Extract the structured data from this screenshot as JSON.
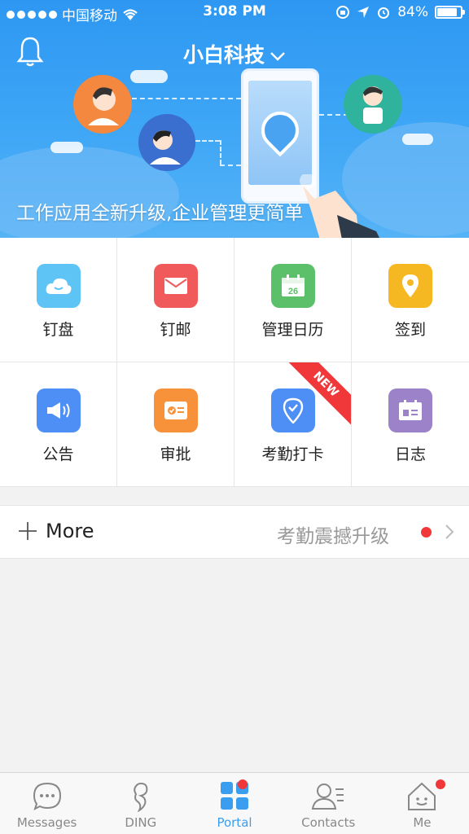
{
  "status_bar": {
    "carrier": "中国移动",
    "time": "3:08 PM",
    "battery_percent": "84%",
    "battery_level": 0.84
  },
  "header": {
    "org_name": "小白科技",
    "banner_text": "工作应用全新升级,企业管理更简单"
  },
  "apps": [
    {
      "label": "钉盘",
      "icon": "cloud-icon",
      "color": "#5ec4f5"
    },
    {
      "label": "钉邮",
      "icon": "mail-icon",
      "color": "#f15a5a"
    },
    {
      "label": "管理日历",
      "icon": "calendar-icon",
      "color": "#5cbf6a",
      "icon_text": "26"
    },
    {
      "label": "签到",
      "icon": "location-pin-icon",
      "color": "#f5b822"
    },
    {
      "label": "公告",
      "icon": "megaphone-icon",
      "color": "#4d8ff5"
    },
    {
      "label": "审批",
      "icon": "approval-card-icon",
      "color": "#f7923a"
    },
    {
      "label": "考勤打卡",
      "icon": "check-in-pin-icon",
      "color": "#4d8ff5",
      "badge": "NEW"
    },
    {
      "label": "日志",
      "icon": "log-icon",
      "color": "#9b82c9"
    }
  ],
  "more": {
    "label": "More",
    "promo": "考勤震撼升级"
  },
  "tabs": [
    {
      "label": "Messages",
      "icon": "chat-bubble-icon",
      "active": false,
      "dot": false
    },
    {
      "label": "DING",
      "icon": "ding-icon",
      "active": false,
      "dot": false
    },
    {
      "label": "Portal",
      "icon": "portal-grid-icon",
      "active": true,
      "dot": true
    },
    {
      "label": "Contacts",
      "icon": "contacts-icon",
      "active": false,
      "dot": false
    },
    {
      "label": "Me",
      "icon": "home-face-icon",
      "active": false,
      "dot": true
    }
  ],
  "colors": {
    "accent": "#3a9ef0",
    "badge_red": "#f0383a",
    "banner_blue": "#2d97f2"
  }
}
